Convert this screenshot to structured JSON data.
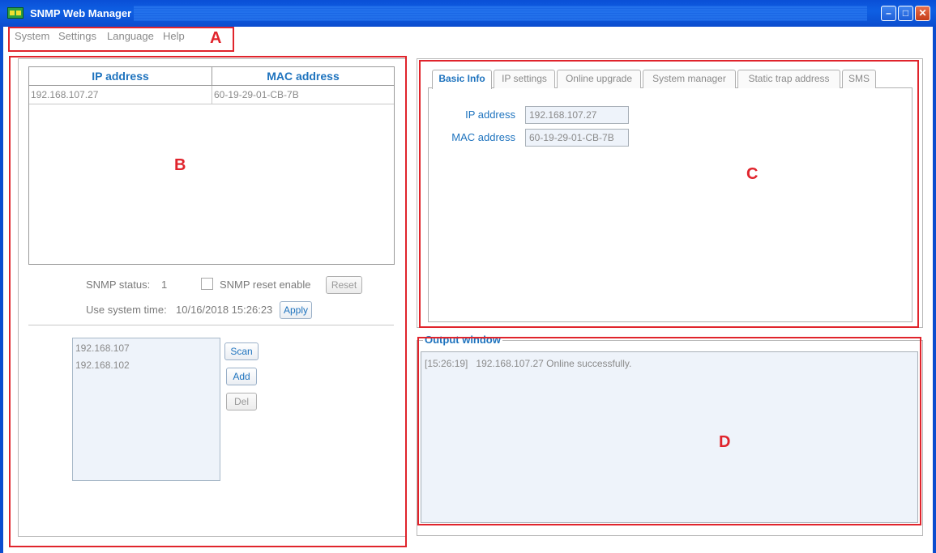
{
  "window": {
    "title": "SNMP Web Manager",
    "minimize": "–",
    "maximize": "□",
    "close": "✕"
  },
  "menu": [
    "System",
    "Settings",
    "Language",
    "Help"
  ],
  "annotations": {
    "a": "A",
    "b": "B",
    "c": "C",
    "d": "D"
  },
  "device_table": {
    "columns": [
      "IP address",
      "MAC address"
    ],
    "rows": [
      {
        "ip": "192.168.107.27",
        "mac": "60-19-29-01-CB-7B"
      }
    ]
  },
  "snmp": {
    "status_label": "SNMP status:",
    "status_value": "1",
    "reset_enable_label": "SNMP reset enable",
    "reset_enabled": false,
    "reset_button": "Reset",
    "time_label": "Use system time:",
    "time_value": "10/16/2018 15:26:23",
    "apply_button": "Apply"
  },
  "subnets": {
    "items": [
      "192.168.107",
      "192.168.102"
    ],
    "scan_button": "Scan",
    "add_button": "Add",
    "del_button": "Del"
  },
  "tabs": {
    "items": [
      "Basic Info",
      "IP settings",
      "Online upgrade",
      "System manager",
      "Static trap address",
      "SMS"
    ],
    "active": "Basic Info"
  },
  "basic_info": {
    "ip_label": "IP address",
    "ip_value": "192.168.107.27",
    "mac_label": "MAC address",
    "mac_value": "60-19-29-01-CB-7B"
  },
  "output": {
    "title": "Output window",
    "lines": [
      {
        "time": "[15:26:19]",
        "message": "192.168.107.27 Online successfully."
      }
    ]
  },
  "colors": {
    "accent": "#1e73be",
    "highlight_box": "#e0242c",
    "titlebar": "#0b4dcf"
  }
}
